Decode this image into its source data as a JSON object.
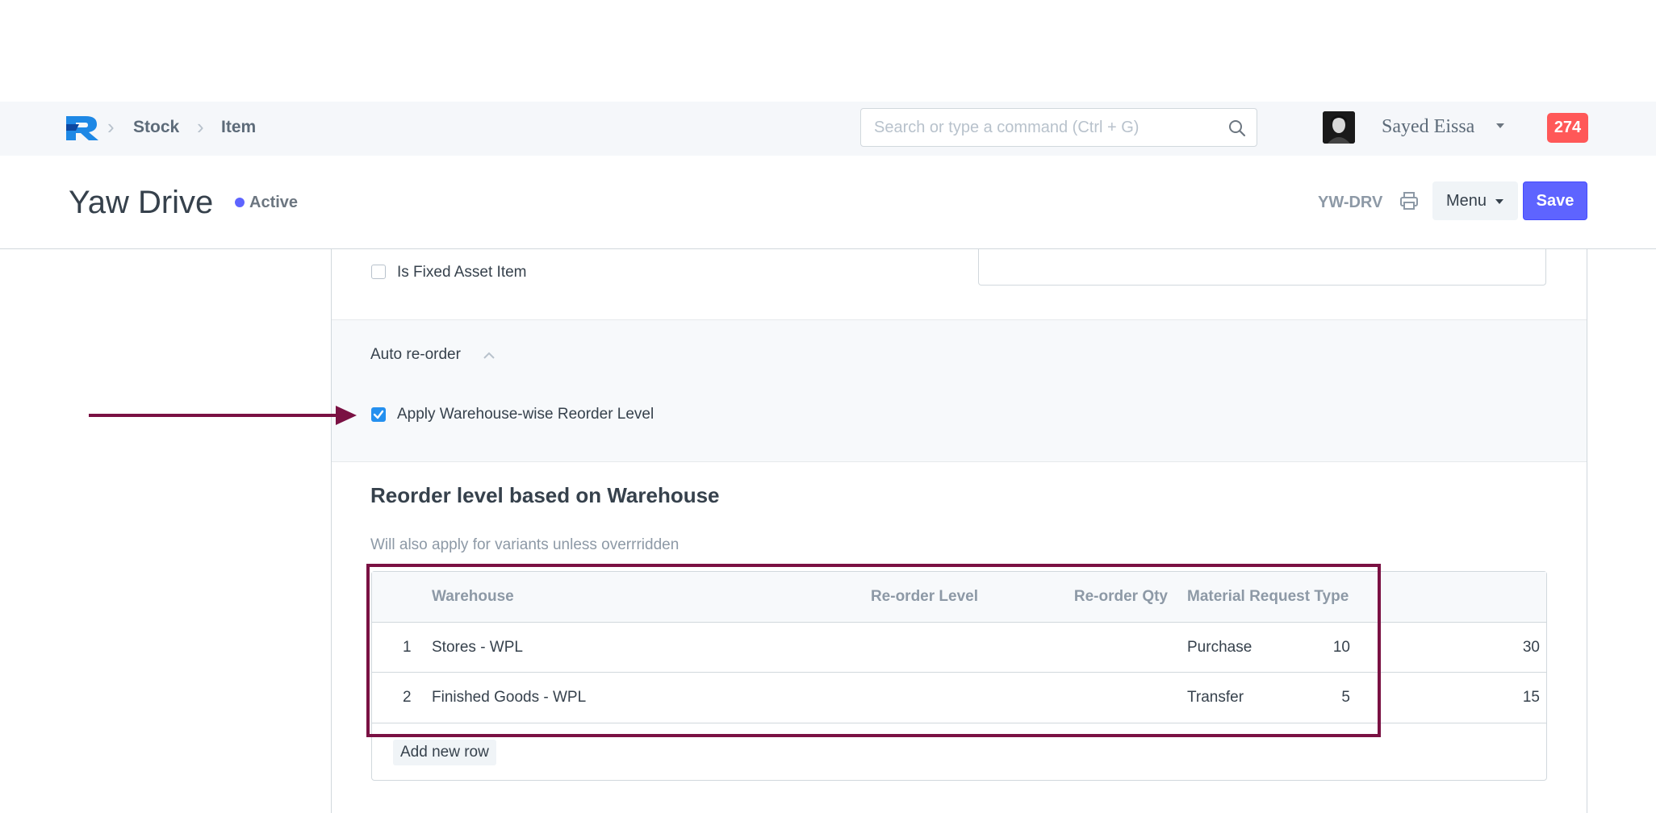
{
  "navbar": {
    "breadcrumbs": [
      "Stock",
      "Item"
    ],
    "search_placeholder": "Search or type a command (Ctrl + G)",
    "user_name": "Sayed Eissa",
    "notification_count": "274"
  },
  "page": {
    "title": "Yaw Drive",
    "status": "Active",
    "doc_name": "YW-DRV",
    "menu_label": "Menu",
    "save_label": "Save"
  },
  "form": {
    "fixed_asset_label": "Is Fixed Asset Item",
    "fixed_asset_checked": false,
    "auto_reorder_section": "Auto re-order",
    "apply_warehouse_label": "Apply Warehouse-wise Reorder Level",
    "apply_warehouse_checked": true,
    "reorder_heading": "Reorder level based on Warehouse",
    "reorder_help": "Will also apply for variants unless overrridden"
  },
  "reorder_table": {
    "columns": [
      "Warehouse",
      "Re-order Level",
      "Re-order Qty",
      "Material Request Type"
    ],
    "rows": [
      {
        "idx": "1",
        "warehouse": "Stores - WPL",
        "level": "10",
        "qty": "30",
        "type": "Purchase"
      },
      {
        "idx": "2",
        "warehouse": "Finished Goods - WPL",
        "level": "5",
        "qty": "15",
        "type": "Transfer"
      }
    ],
    "add_row_label": "Add new row"
  },
  "colors": {
    "primary": "#5e64ff",
    "notification": "#ff5858",
    "annotation": "#7a1143",
    "checkbox": "#2490ef"
  }
}
